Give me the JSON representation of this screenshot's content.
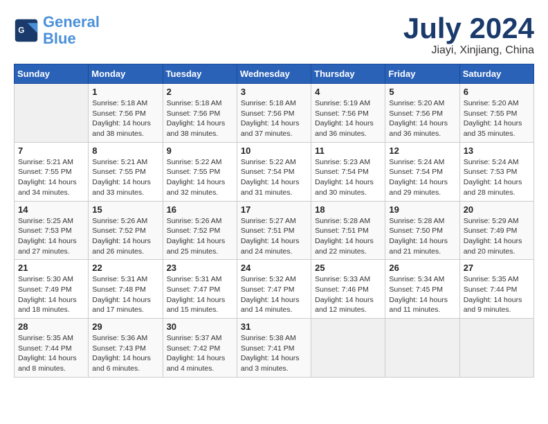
{
  "header": {
    "logo_general": "General",
    "logo_blue": "Blue",
    "month_title": "July 2024",
    "location": "Jiayi, Xinjiang, China"
  },
  "days_of_week": [
    "Sunday",
    "Monday",
    "Tuesday",
    "Wednesday",
    "Thursday",
    "Friday",
    "Saturday"
  ],
  "weeks": [
    [
      {
        "day": "",
        "info": ""
      },
      {
        "day": "1",
        "info": "Sunrise: 5:18 AM\nSunset: 7:56 PM\nDaylight: 14 hours\nand 38 minutes."
      },
      {
        "day": "2",
        "info": "Sunrise: 5:18 AM\nSunset: 7:56 PM\nDaylight: 14 hours\nand 38 minutes."
      },
      {
        "day": "3",
        "info": "Sunrise: 5:18 AM\nSunset: 7:56 PM\nDaylight: 14 hours\nand 37 minutes."
      },
      {
        "day": "4",
        "info": "Sunrise: 5:19 AM\nSunset: 7:56 PM\nDaylight: 14 hours\nand 36 minutes."
      },
      {
        "day": "5",
        "info": "Sunrise: 5:20 AM\nSunset: 7:56 PM\nDaylight: 14 hours\nand 36 minutes."
      },
      {
        "day": "6",
        "info": "Sunrise: 5:20 AM\nSunset: 7:55 PM\nDaylight: 14 hours\nand 35 minutes."
      }
    ],
    [
      {
        "day": "7",
        "info": "Sunrise: 5:21 AM\nSunset: 7:55 PM\nDaylight: 14 hours\nand 34 minutes."
      },
      {
        "day": "8",
        "info": "Sunrise: 5:21 AM\nSunset: 7:55 PM\nDaylight: 14 hours\nand 33 minutes."
      },
      {
        "day": "9",
        "info": "Sunrise: 5:22 AM\nSunset: 7:55 PM\nDaylight: 14 hours\nand 32 minutes."
      },
      {
        "day": "10",
        "info": "Sunrise: 5:22 AM\nSunset: 7:54 PM\nDaylight: 14 hours\nand 31 minutes."
      },
      {
        "day": "11",
        "info": "Sunrise: 5:23 AM\nSunset: 7:54 PM\nDaylight: 14 hours\nand 30 minutes."
      },
      {
        "day": "12",
        "info": "Sunrise: 5:24 AM\nSunset: 7:54 PM\nDaylight: 14 hours\nand 29 minutes."
      },
      {
        "day": "13",
        "info": "Sunrise: 5:24 AM\nSunset: 7:53 PM\nDaylight: 14 hours\nand 28 minutes."
      }
    ],
    [
      {
        "day": "14",
        "info": "Sunrise: 5:25 AM\nSunset: 7:53 PM\nDaylight: 14 hours\nand 27 minutes."
      },
      {
        "day": "15",
        "info": "Sunrise: 5:26 AM\nSunset: 7:52 PM\nDaylight: 14 hours\nand 26 minutes."
      },
      {
        "day": "16",
        "info": "Sunrise: 5:26 AM\nSunset: 7:52 PM\nDaylight: 14 hours\nand 25 minutes."
      },
      {
        "day": "17",
        "info": "Sunrise: 5:27 AM\nSunset: 7:51 PM\nDaylight: 14 hours\nand 24 minutes."
      },
      {
        "day": "18",
        "info": "Sunrise: 5:28 AM\nSunset: 7:51 PM\nDaylight: 14 hours\nand 22 minutes."
      },
      {
        "day": "19",
        "info": "Sunrise: 5:28 AM\nSunset: 7:50 PM\nDaylight: 14 hours\nand 21 minutes."
      },
      {
        "day": "20",
        "info": "Sunrise: 5:29 AM\nSunset: 7:49 PM\nDaylight: 14 hours\nand 20 minutes."
      }
    ],
    [
      {
        "day": "21",
        "info": "Sunrise: 5:30 AM\nSunset: 7:49 PM\nDaylight: 14 hours\nand 18 minutes."
      },
      {
        "day": "22",
        "info": "Sunrise: 5:31 AM\nSunset: 7:48 PM\nDaylight: 14 hours\nand 17 minutes."
      },
      {
        "day": "23",
        "info": "Sunrise: 5:31 AM\nSunset: 7:47 PM\nDaylight: 14 hours\nand 15 minutes."
      },
      {
        "day": "24",
        "info": "Sunrise: 5:32 AM\nSunset: 7:47 PM\nDaylight: 14 hours\nand 14 minutes."
      },
      {
        "day": "25",
        "info": "Sunrise: 5:33 AM\nSunset: 7:46 PM\nDaylight: 14 hours\nand 12 minutes."
      },
      {
        "day": "26",
        "info": "Sunrise: 5:34 AM\nSunset: 7:45 PM\nDaylight: 14 hours\nand 11 minutes."
      },
      {
        "day": "27",
        "info": "Sunrise: 5:35 AM\nSunset: 7:44 PM\nDaylight: 14 hours\nand 9 minutes."
      }
    ],
    [
      {
        "day": "28",
        "info": "Sunrise: 5:35 AM\nSunset: 7:44 PM\nDaylight: 14 hours\nand 8 minutes."
      },
      {
        "day": "29",
        "info": "Sunrise: 5:36 AM\nSunset: 7:43 PM\nDaylight: 14 hours\nand 6 minutes."
      },
      {
        "day": "30",
        "info": "Sunrise: 5:37 AM\nSunset: 7:42 PM\nDaylight: 14 hours\nand 4 minutes."
      },
      {
        "day": "31",
        "info": "Sunrise: 5:38 AM\nSunset: 7:41 PM\nDaylight: 14 hours\nand 3 minutes."
      },
      {
        "day": "",
        "info": ""
      },
      {
        "day": "",
        "info": ""
      },
      {
        "day": "",
        "info": ""
      }
    ]
  ]
}
